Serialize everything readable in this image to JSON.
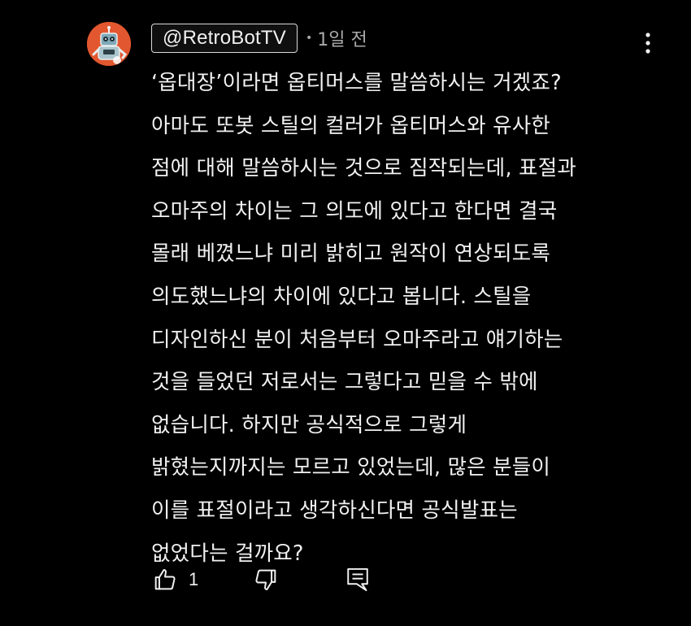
{
  "comment": {
    "author_handle": "@RetroBotTV",
    "separator": "•",
    "timestamp": "1일 전",
    "lines": [
      "‘옵대장’이라면 옵티머스를 말씀하시는 거겠죠?",
      "아마도 또봇 스틸의 컬러가 옵티머스와 유사한",
      "점에 대해 말씀하시는 것으로 짐작되는데, 표절과",
      "오마주의 차이는 그 의도에 있다고 한다면 결국",
      "몰래 베꼈느냐 미리 밝히고 원작이 연상되도록",
      "의도했느냐의 차이에 있다고 봅니다. 스틸을",
      "디자인하신 분이 처음부터 오마주라고 얘기하는",
      "것을 들었던 저로서는 그렇다고 믿을 수 밖에",
      "없습니다. 하지만 공식적으로 그렇게",
      "밝혔는지까지는 모르고 있었는데, 많은 분들이",
      "이를 표절이라고 생각하신다면 공식발표는",
      "없었다는 걸까요?"
    ],
    "like_count": "1"
  },
  "icons": {
    "avatar": "robot-avatar",
    "more": "more-vert-icon",
    "like": "thumb-up-icon",
    "dislike": "thumb-down-icon",
    "reply": "reply-comment-icon"
  },
  "colors": {
    "background": "#000000",
    "text_primary": "#f1f1f1",
    "text_secondary": "#aaaaaa",
    "avatar_bg": "#e2572f"
  }
}
